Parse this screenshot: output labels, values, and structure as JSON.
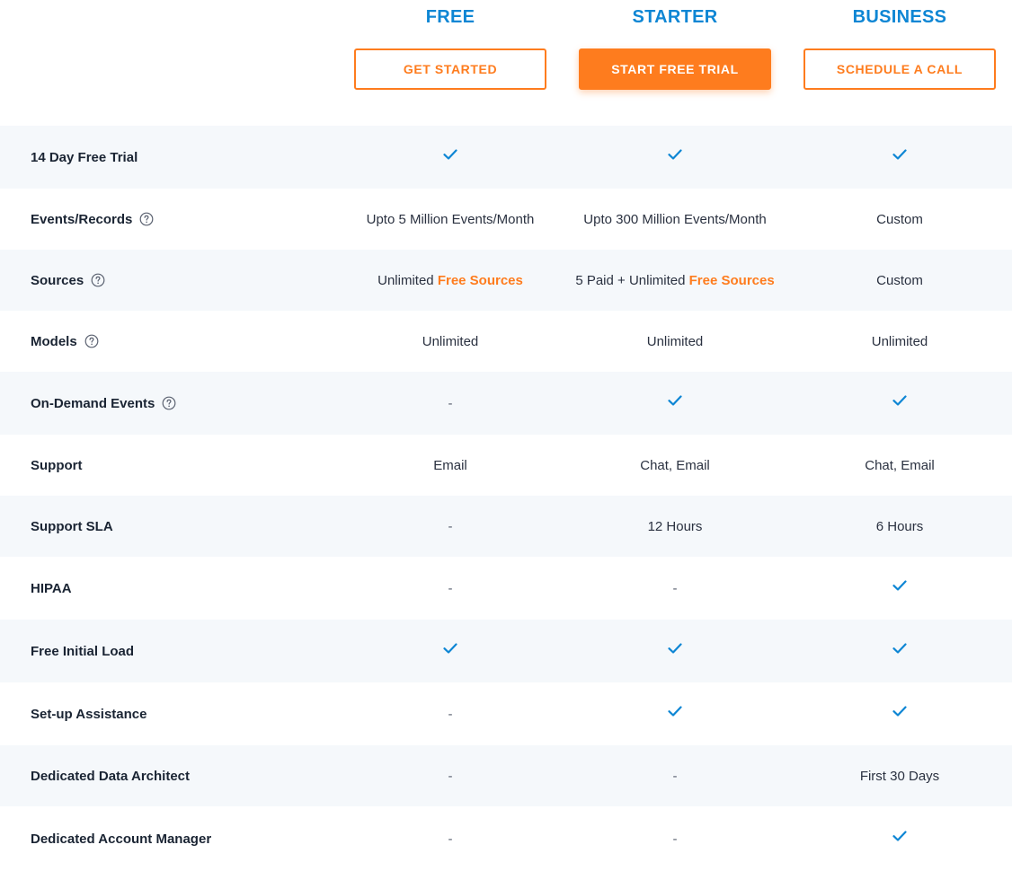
{
  "plans": [
    {
      "name": "FREE",
      "button": "GET STARTED",
      "primary": false
    },
    {
      "name": "STARTER",
      "button": "START FREE TRIAL",
      "primary": true
    },
    {
      "name": "BUSINESS",
      "button": "SCHEDULE A CALL",
      "primary": false
    }
  ],
  "rows": [
    {
      "feature": "14 Day Free Trial",
      "help": false,
      "cells": [
        {
          "type": "check"
        },
        {
          "type": "check"
        },
        {
          "type": "check"
        }
      ]
    },
    {
      "feature": "Events/Records",
      "help": true,
      "cells": [
        {
          "type": "text",
          "text": "Upto 5 Million Events/Month"
        },
        {
          "type": "text",
          "text": "Upto 300 Million Events/Month"
        },
        {
          "type": "text",
          "text": "Custom"
        }
      ]
    },
    {
      "feature": "Sources",
      "help": true,
      "cells": [
        {
          "type": "text",
          "text": "Unlimited ",
          "highlight": "Free Sources"
        },
        {
          "type": "text",
          "text": "5 Paid + Unlimited ",
          "highlight": "Free Sources"
        },
        {
          "type": "text",
          "text": "Custom"
        }
      ]
    },
    {
      "feature": "Models",
      "help": true,
      "cells": [
        {
          "type": "text",
          "text": "Unlimited"
        },
        {
          "type": "text",
          "text": "Unlimited"
        },
        {
          "type": "text",
          "text": "Unlimited"
        }
      ]
    },
    {
      "feature": "On-Demand Events",
      "help": true,
      "cells": [
        {
          "type": "dash",
          "text": "-"
        },
        {
          "type": "check"
        },
        {
          "type": "check"
        }
      ]
    },
    {
      "feature": "Support",
      "help": false,
      "cells": [
        {
          "type": "text",
          "text": "Email"
        },
        {
          "type": "text",
          "text": "Chat, Email"
        },
        {
          "type": "text",
          "text": "Chat, Email"
        }
      ]
    },
    {
      "feature": "Support SLA",
      "help": false,
      "cells": [
        {
          "type": "dash",
          "text": "-"
        },
        {
          "type": "text",
          "text": "12 Hours"
        },
        {
          "type": "text",
          "text": "6 Hours"
        }
      ]
    },
    {
      "feature": "HIPAA",
      "help": false,
      "cells": [
        {
          "type": "dash",
          "text": "-"
        },
        {
          "type": "dash",
          "text": "-"
        },
        {
          "type": "check"
        }
      ]
    },
    {
      "feature": "Free Initial Load",
      "help": false,
      "cells": [
        {
          "type": "check"
        },
        {
          "type": "check"
        },
        {
          "type": "check"
        }
      ]
    },
    {
      "feature": "Set-up Assistance",
      "help": false,
      "cells": [
        {
          "type": "dash",
          "text": "-"
        },
        {
          "type": "check"
        },
        {
          "type": "check"
        }
      ]
    },
    {
      "feature": "Dedicated Data Architect",
      "help": false,
      "cells": [
        {
          "type": "dash",
          "text": "-"
        },
        {
          "type": "dash",
          "text": "-"
        },
        {
          "type": "text",
          "text": "First 30 Days"
        }
      ]
    },
    {
      "feature": "Dedicated Account Manager",
      "help": false,
      "cells": [
        {
          "type": "dash",
          "text": "-"
        },
        {
          "type": "dash",
          "text": "-"
        },
        {
          "type": "check"
        }
      ]
    }
  ],
  "colors": {
    "accent": "#fe7c1e",
    "brand_blue": "#0e86d4",
    "row_shade": "#f5f8fb",
    "text": "#1a2433"
  },
  "icons": {
    "check": "check-icon",
    "help": "help-circle-icon"
  }
}
